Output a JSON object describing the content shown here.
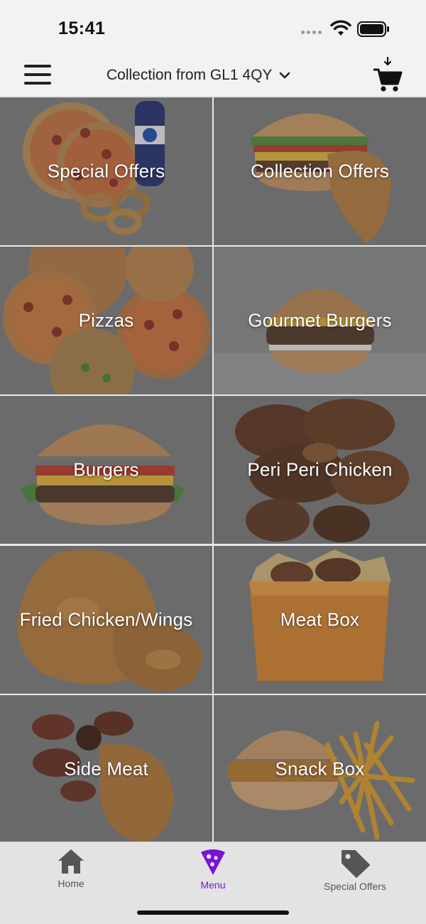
{
  "status_bar": {
    "time": "15:41"
  },
  "header": {
    "location_label": "Collection from GL1 4QY",
    "menu_icon": "hamburger-icon",
    "cart_icon": "cart-icon"
  },
  "categories": [
    {
      "label": "Special Offers"
    },
    {
      "label": "Collection Offers"
    },
    {
      "label": "Pizzas"
    },
    {
      "label": "Gourmet Burgers"
    },
    {
      "label": "Burgers"
    },
    {
      "label": "Peri Peri Chicken"
    },
    {
      "label": "Fried Chicken/Wings"
    },
    {
      "label": "Meat Box"
    },
    {
      "label": "Side Meat"
    },
    {
      "label": "Snack Box"
    }
  ],
  "tabs": [
    {
      "label": "Home",
      "icon": "home-icon",
      "active": false
    },
    {
      "label": "Menu",
      "icon": "pizza-slice-icon",
      "active": true
    },
    {
      "label": "Special Offers",
      "icon": "tag-icon",
      "active": false
    }
  ],
  "colors": {
    "accent": "#7a12d9",
    "tile_overlay": "#6d6d6d"
  }
}
